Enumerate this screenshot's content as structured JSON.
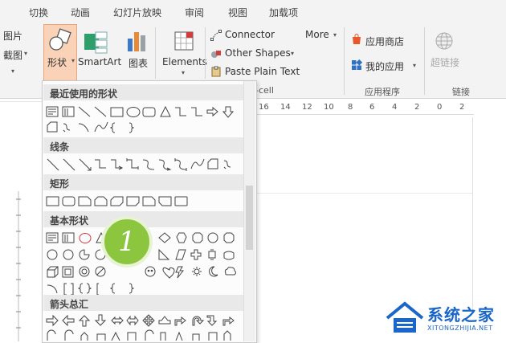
{
  "tabs": [
    "切换",
    "动画",
    "幻灯片放映",
    "审阅",
    "视图",
    "加载项"
  ],
  "left_cut": {
    "line1": "图片",
    "line2": "截图"
  },
  "buttons": {
    "shapes": "形状",
    "smartart": "SmartArt",
    "chart": "图表",
    "elements": "Elements",
    "connector": "Connector",
    "other_shapes": "Other Shapes",
    "paste_plain_text": "Paste Plain Text",
    "more": "More",
    "app_store": "应用商店",
    "my_apps": "我的应用",
    "hyperlink": "超链接"
  },
  "groups": {
    "cell": "-cell",
    "apps": "应用程序",
    "links": "链接"
  },
  "ruler": {
    "labels": [
      "16",
      "14",
      "12",
      "10",
      "8",
      "6",
      "4",
      "2",
      "0",
      "2"
    ]
  },
  "panel": {
    "categories": [
      "最近使用的形状",
      "线条",
      "矩形",
      "基本形状",
      "箭头总汇"
    ]
  },
  "badge": {
    "number": "1"
  },
  "watermark": {
    "title": "系统之家",
    "url": "XITONGZHIJIA.NET"
  },
  "colors": {
    "accent": "#8cc63f",
    "selected": "#f9d2b7",
    "brand": "#1a66c9"
  }
}
